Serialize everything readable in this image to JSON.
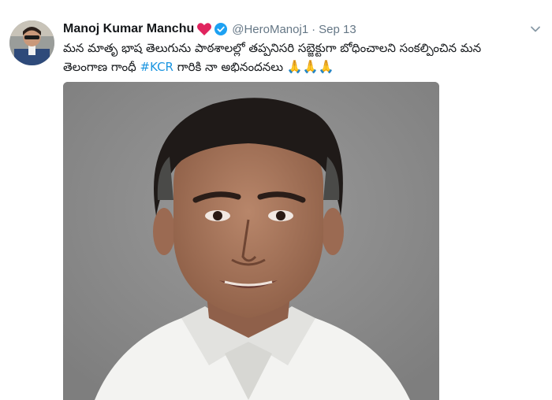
{
  "tweet": {
    "name": "Manoj Kumar Manchu",
    "handle": "@HeroManoj1",
    "separator": "·",
    "date": "Sep 13",
    "text_line1": "మన మాతృ భాష తెలుగును పాఠశాలల్లో తప్పనిసరి సబ్జెక్టుగా బోధించాలని సంకల్పించిన మన",
    "text_line2_pre": "తెలంగాణ గాంధీ ",
    "hashtag": "#KCR",
    "text_line2_post": " గారికి నా అభినందనలు ",
    "emojis": "🙏🙏🙏"
  },
  "icons": {
    "name_decoration": "heart-icon",
    "verified": "verified-badge-icon",
    "menu": "chevron-down-icon"
  },
  "colors": {
    "hashtag": "#1b95e0",
    "verified": "#1da1f2",
    "heart": "#e0245e",
    "secondary_text": "#657786",
    "media_background": "#8b8b8b"
  }
}
